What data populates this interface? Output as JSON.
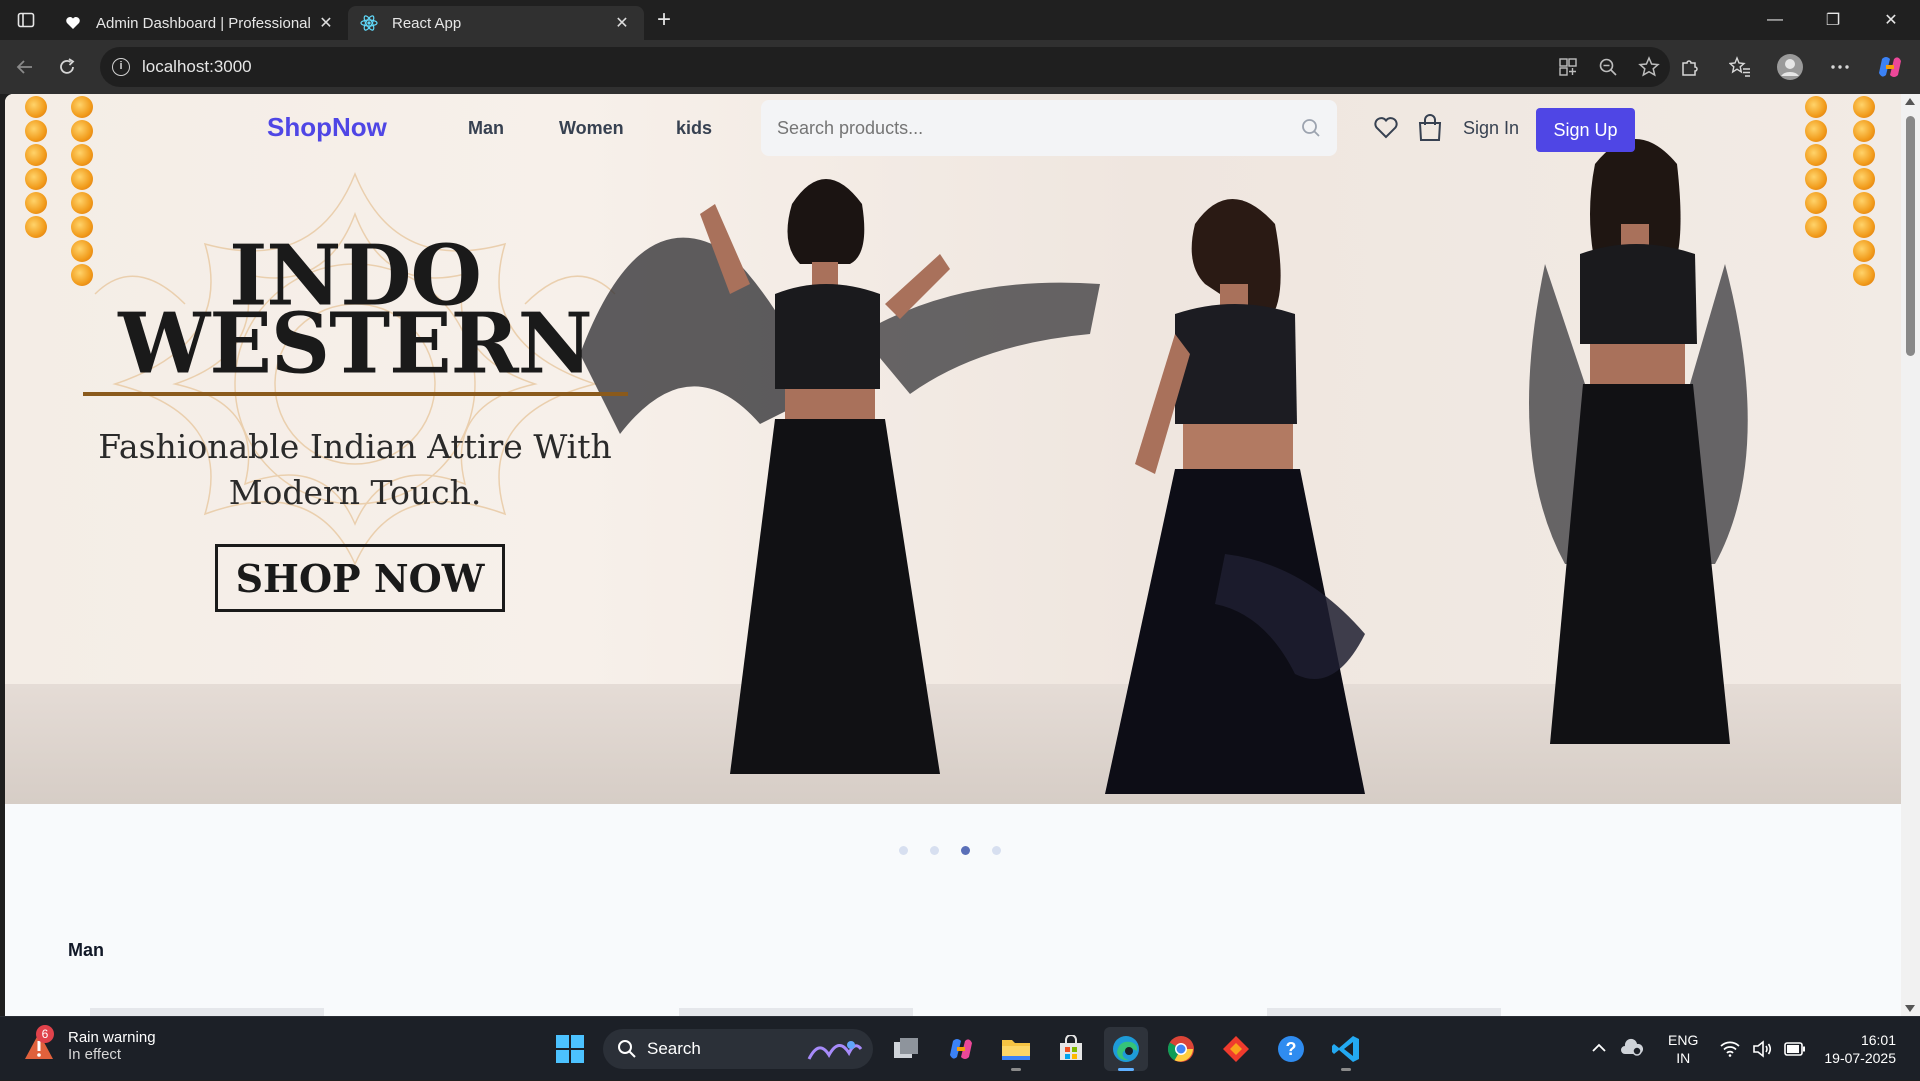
{
  "browser": {
    "tabs": [
      {
        "title": "Admin Dashboard | Professional M",
        "active": false
      },
      {
        "title": "React App",
        "active": true
      }
    ],
    "address": "localhost:3000"
  },
  "site": {
    "brand": "ShopNow",
    "nav": [
      "Man",
      "Women",
      "kids"
    ],
    "search_placeholder": "Search products...",
    "signin": "Sign In",
    "signup": "Sign Up",
    "accent": "#4f46e5"
  },
  "hero": {
    "title_line1": "INDO",
    "title_line2": "WESTERN",
    "subtitle_line1": "Fashionable Indian Attire With",
    "subtitle_line2": "Modern Touch.",
    "cta": "SHOP NOW",
    "slides_total": 4,
    "active_slide": 3
  },
  "section": {
    "title": "Man"
  },
  "taskbar": {
    "weather_title": "Rain warning",
    "weather_sub": "In effect",
    "weather_badge": "6",
    "search_label": "Search",
    "lang_line1": "ENG",
    "lang_line2": "IN",
    "time": "16:01",
    "date": "19-07-2025"
  }
}
